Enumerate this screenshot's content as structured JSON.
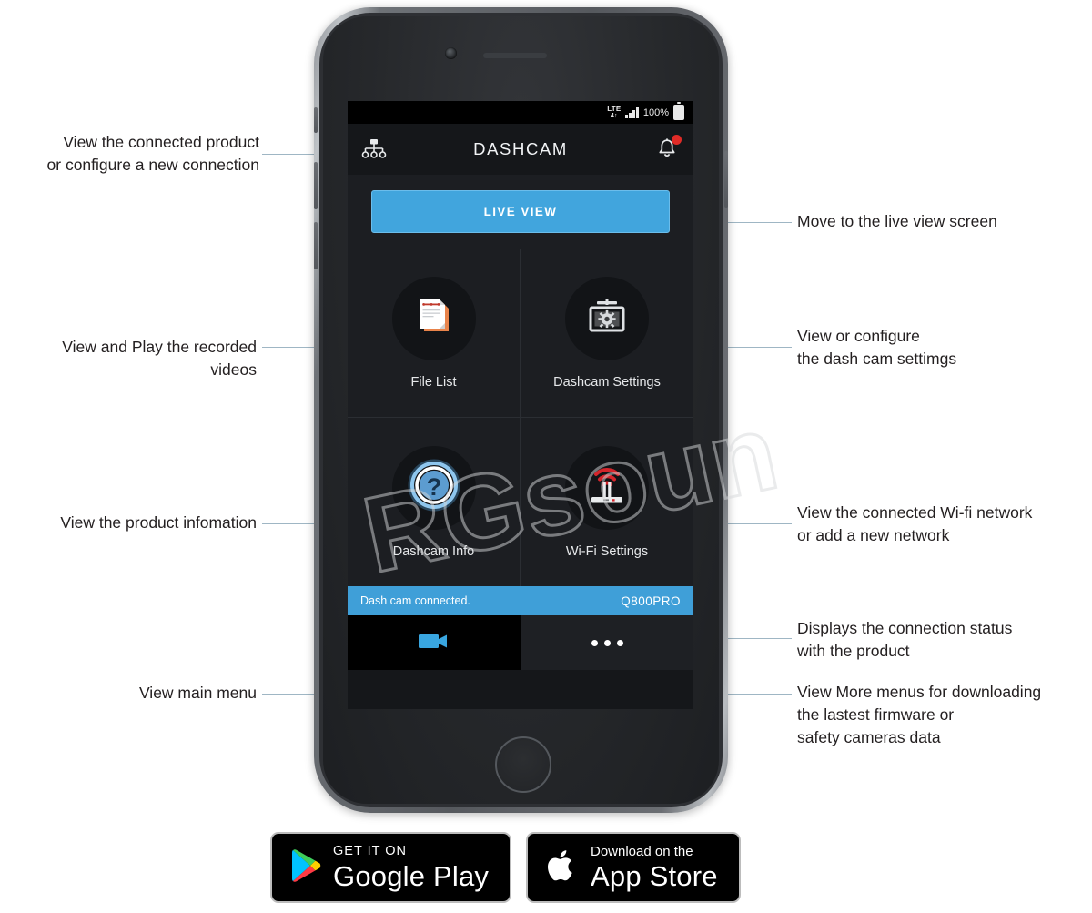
{
  "phone": {
    "status_bar": {
      "network_label": "LTE",
      "network_sub": "4↑",
      "battery_percent": "100%",
      "signal_icon": "signal-bars-icon",
      "battery_icon": "battery-full-icon"
    },
    "app_bar": {
      "title": "DASHCAM",
      "left_icon": "connection-tree-icon",
      "right_icon": "notification-bell-icon",
      "notification_badge": ""
    },
    "live_view": {
      "label": "LIVE VIEW"
    },
    "menu": [
      {
        "label": "File List",
        "icon": "documents-icon"
      },
      {
        "label": "Dashcam Settings",
        "icon": "dashcam-gear-icon"
      },
      {
        "label": "Dashcam Info",
        "icon": "question-mark-icon"
      },
      {
        "label": "Wi-Fi Settings",
        "icon": "wifi-router-icon"
      }
    ],
    "connection_strip": {
      "status_text": "Dash cam connected.",
      "model": "Q800PRO"
    },
    "bottom_nav": [
      {
        "name": "main-menu",
        "icon": "video-camera-icon"
      },
      {
        "name": "more-menu",
        "icon": "more-dots-icon"
      }
    ]
  },
  "callouts": {
    "connection": "View the connected product\nor configure a new connection",
    "file_list": "View and Play the recorded\nvideos",
    "product_info": "View the product infomation",
    "main_menu": "View main menu",
    "live_view": "Move to the live view screen",
    "dashcam_settings": "View or configure\nthe dash cam settimgs",
    "wifi_settings": "View the connected Wi-fi network\nor add a new network",
    "connection_status": "Displays the connection status\nwith the product",
    "more_menu": "View More menus for downloading\nthe lastest firmware or\nsafety cameras data"
  },
  "store_badges": {
    "google_play": {
      "small": "GET IT ON",
      "big": "Google Play",
      "icon": "google-play-icon"
    },
    "app_store": {
      "small": "Download on the",
      "big": "App Store",
      "icon": "apple-logo-icon"
    }
  },
  "watermark": {
    "text": "RGsound"
  },
  "colors": {
    "accent_blue": "#41a5dd",
    "strip_blue": "#3f9fd8",
    "badge_red": "#e02b27",
    "leader_line": "#9fb6c4",
    "leader_dot": "#6aa7c9",
    "screen_bg": "#1c1e22"
  }
}
